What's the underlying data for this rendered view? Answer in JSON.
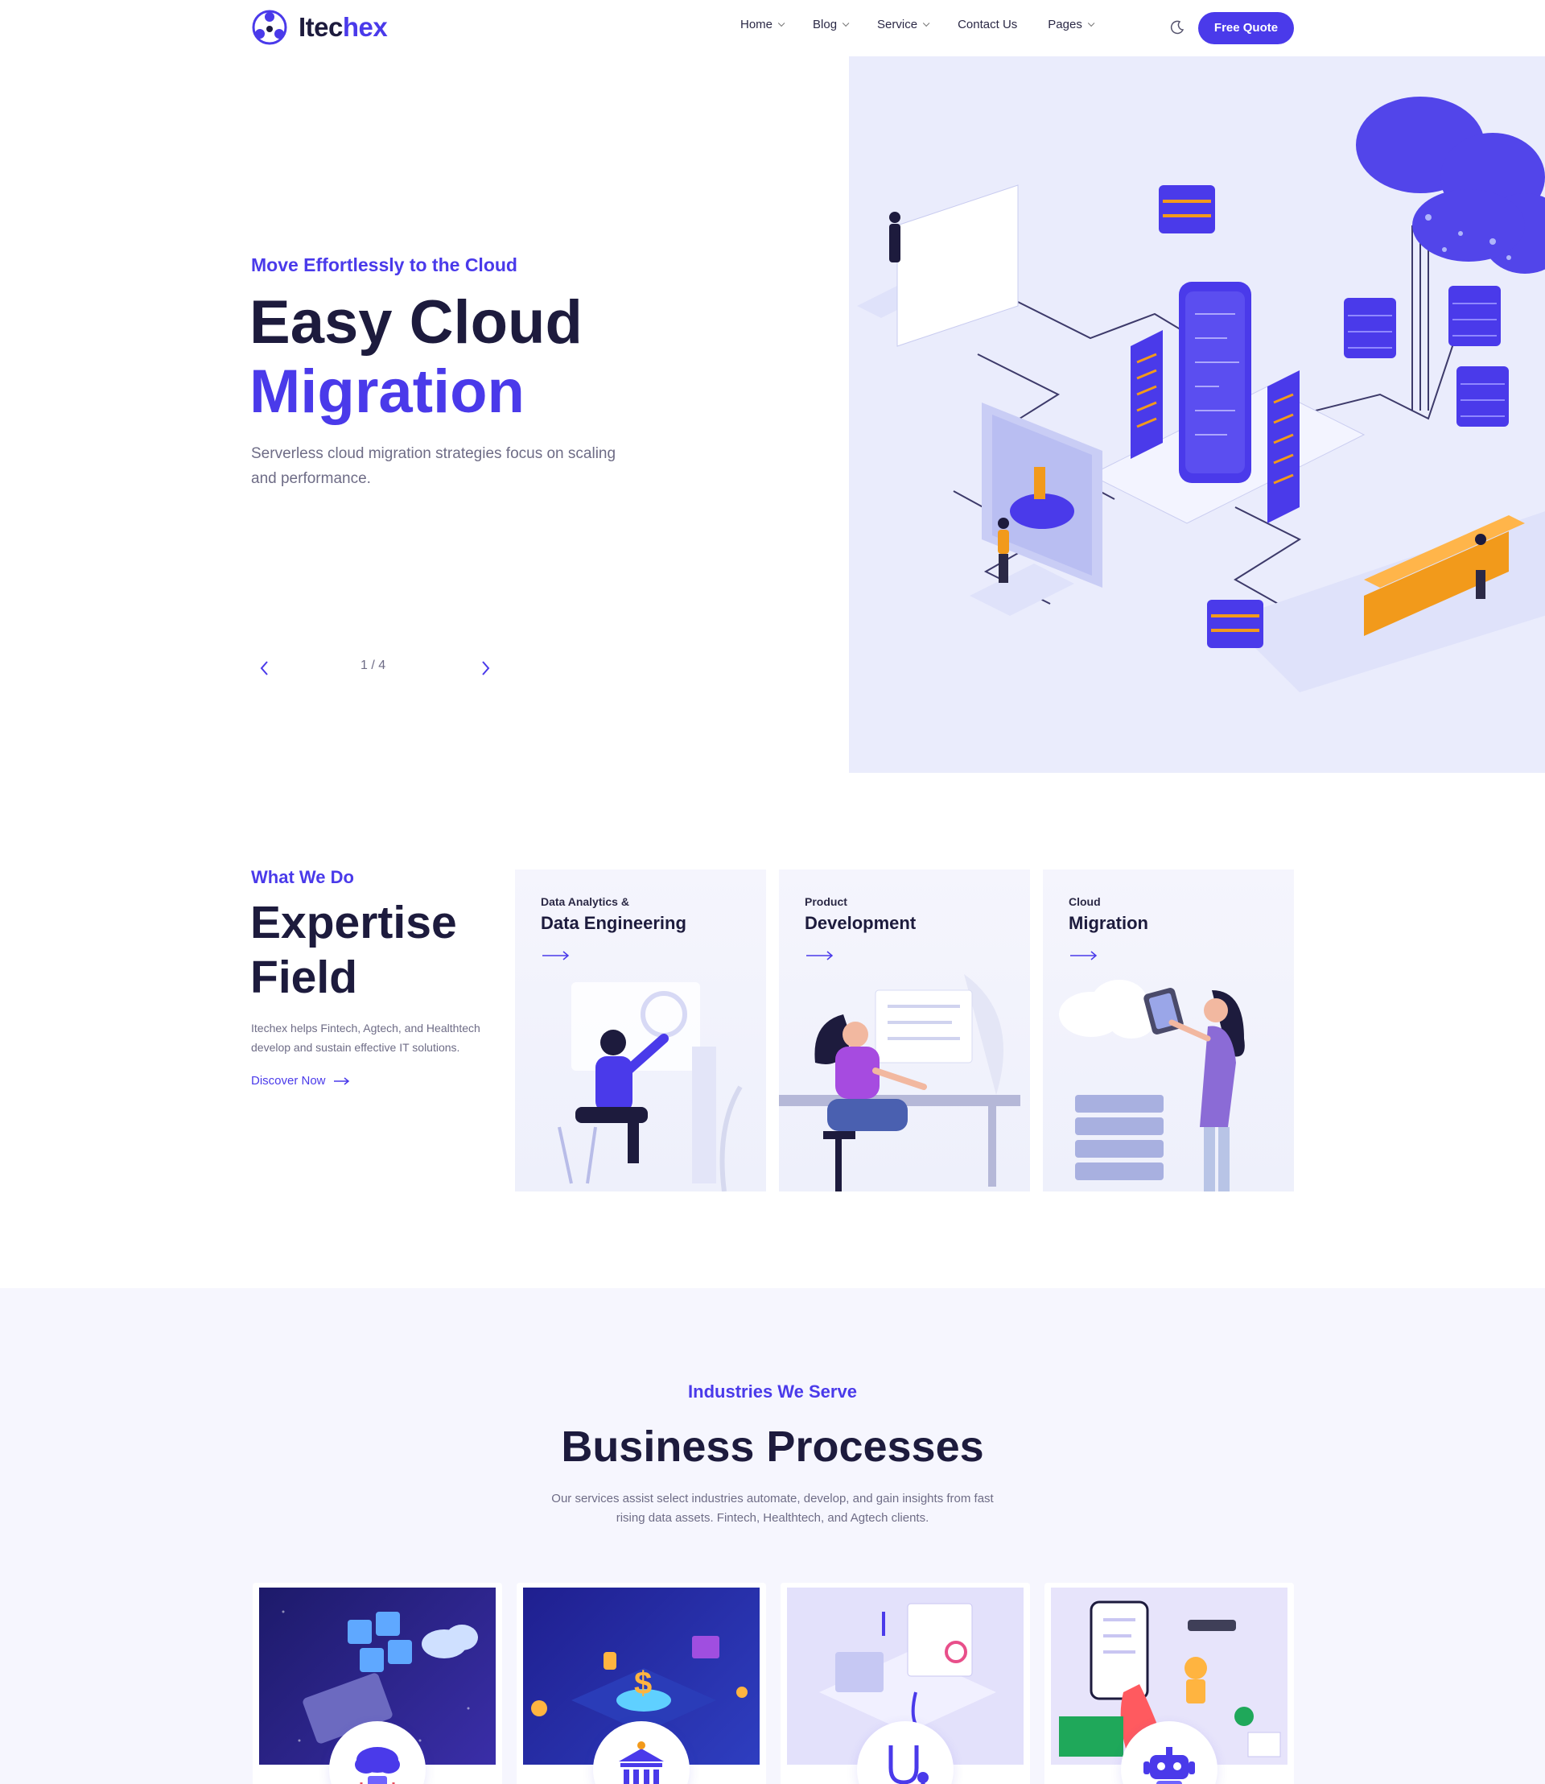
{
  "brand": {
    "name_main": "Itec",
    "name_accent": "hex"
  },
  "nav": {
    "items": [
      {
        "label": "Home",
        "has_dropdown": true
      },
      {
        "label": "Blog",
        "has_dropdown": true
      },
      {
        "label": "Service",
        "has_dropdown": true
      },
      {
        "label": "Contact Us",
        "has_dropdown": false
      },
      {
        "label": "Pages",
        "has_dropdown": true
      }
    ],
    "theme_toggle_icon": "moon-icon",
    "cta_label": "Free Quote"
  },
  "hero": {
    "eyebrow": "Move Effortlessly to the Cloud",
    "title_line1": "Easy Cloud",
    "title_line2": "Migration",
    "description": "Serverless cloud migration strategies focus on scaling and performance.",
    "slider_counter": "1 / 4"
  },
  "expertise": {
    "eyebrow": "What We Do",
    "title_line1": "Expertise",
    "title_line2": "Field",
    "description": "Itechex helps Fintech, Agtech, and Healthtech develop and sustain effective IT solutions.",
    "link_label": "Discover Now",
    "cards": [
      {
        "subtitle": "Data Analytics &",
        "title": "Data Engineering"
      },
      {
        "subtitle": "Product",
        "title": "Development"
      },
      {
        "subtitle": "Cloud",
        "title": "Migration"
      }
    ]
  },
  "industries": {
    "eyebrow": "Industries We Serve",
    "title": "Business Processes",
    "description": "Our services assist select industries automate, develop, and gain insights from fast rising data assets. Fintech, Healthtech, and Agtech clients.",
    "cards": [
      {
        "icon": "cloud-database-icon"
      },
      {
        "icon": "bank-icon"
      },
      {
        "icon": "stethoscope-icon"
      },
      {
        "icon": "robot-icon"
      }
    ]
  },
  "colors": {
    "accent": "#4a3aea",
    "heading": "#1d1b3d",
    "body": "#6e6c86",
    "hero_panel": "#eaecfc",
    "section_bg": "#f6f6fe"
  }
}
